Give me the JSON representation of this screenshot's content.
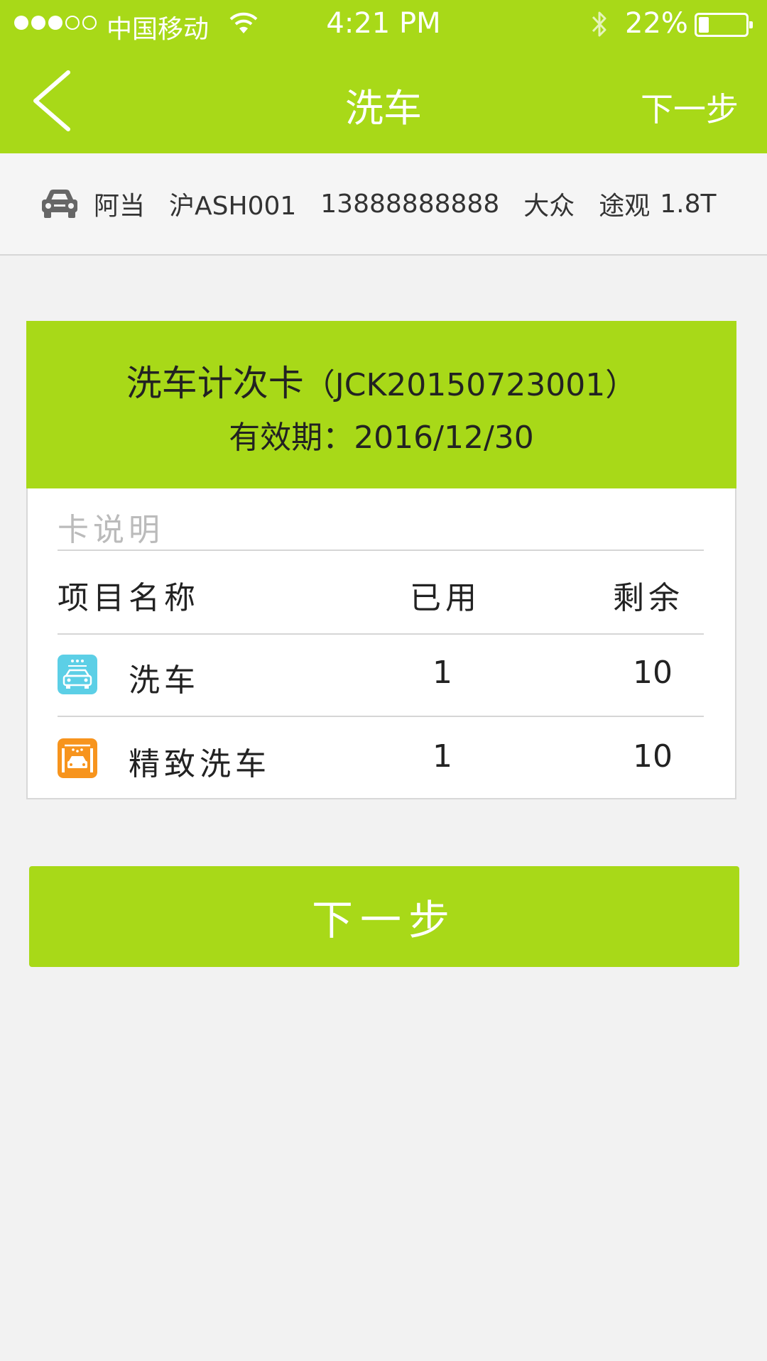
{
  "status_bar": {
    "carrier": "中国移动",
    "time": "4:21 PM",
    "battery": "22%",
    "battery_level": 0.22
  },
  "navbar": {
    "title": "洗车",
    "next_label": "下一步"
  },
  "vehicle": {
    "owner": "阿当",
    "plate": "沪ASH001",
    "phone": "13888888888",
    "brand": "大众",
    "model": "途观",
    "engine": "1.8T"
  },
  "card": {
    "name": "洗车计次卡",
    "number": "JCK20150723001",
    "expiry_label": "有效期：",
    "expiry_date": "2016/12/30",
    "description_label": "卡说明",
    "columns": {
      "item": "项目名称",
      "used": "已用",
      "remaining": "剩余"
    },
    "items": [
      {
        "name": "洗车",
        "used": "1",
        "remaining": "10",
        "icon": "car-wash-icon",
        "color": "#5ccfe6"
      },
      {
        "name": "精致洗车",
        "used": "1",
        "remaining": "10",
        "icon": "premium-car-wash-icon",
        "color": "#f7941d"
      }
    ]
  },
  "actions": {
    "next_label": "下一步"
  },
  "colors": {
    "accent": "#a8d918"
  }
}
